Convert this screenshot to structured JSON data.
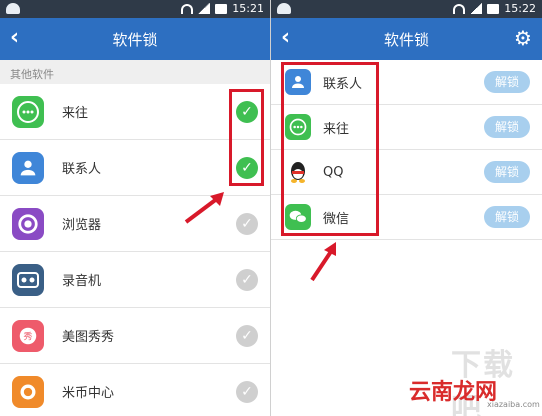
{
  "left": {
    "time": "15:21",
    "title": "软件锁",
    "section": "其他软件",
    "apps": [
      {
        "name": "来往",
        "icon": "laiwang-icon",
        "checked": true
      },
      {
        "name": "联系人",
        "icon": "contacts-icon",
        "checked": true
      },
      {
        "name": "浏览器",
        "icon": "browser-icon",
        "checked": false
      },
      {
        "name": "录音机",
        "icon": "recorder-icon",
        "checked": false
      },
      {
        "name": "美图秀秀",
        "icon": "meitu-icon",
        "checked": false
      },
      {
        "name": "米币中心",
        "icon": "micoin-icon",
        "checked": false
      }
    ]
  },
  "right": {
    "time": "15:22",
    "title": "软件锁",
    "unlock_label": "解锁",
    "apps": [
      {
        "name": "联系人",
        "icon": "contacts-icon"
      },
      {
        "name": "来往",
        "icon": "laiwang-icon"
      },
      {
        "name": "QQ",
        "icon": "qq-icon"
      },
      {
        "name": "微信",
        "icon": "wechat-icon"
      }
    ]
  },
  "watermark": {
    "text": "云南龙网",
    "sub": "xiazaiba.com"
  },
  "colors": {
    "appbar": "#2d6fc1",
    "check_on": "#3fbf51",
    "check_off": "#cfcfcf",
    "unlock": "#a8cfee",
    "highlight": "#d8192a"
  }
}
